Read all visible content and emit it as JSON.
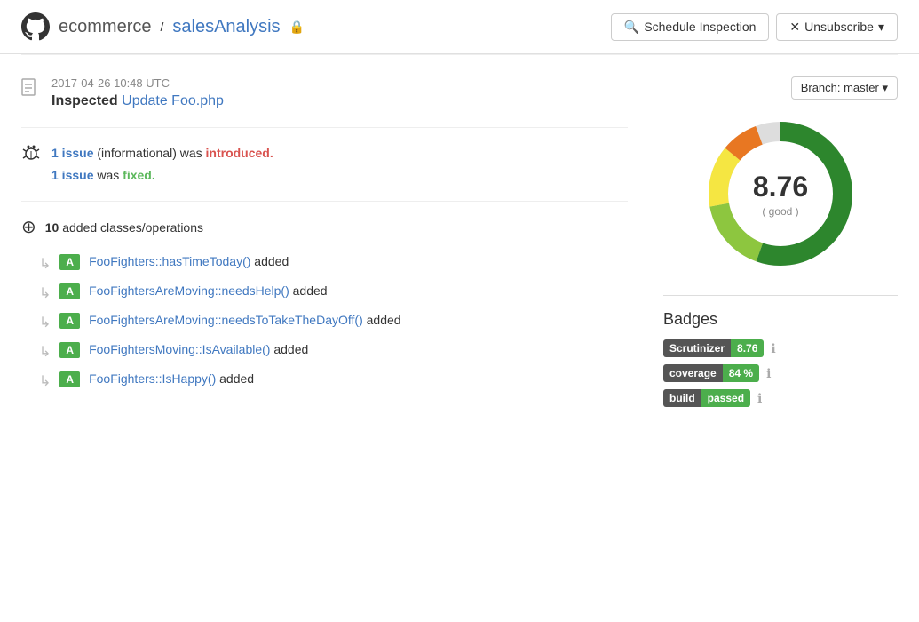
{
  "header": {
    "github_icon": "github-icon",
    "repo_owner": "ecommerce",
    "separator": " / ",
    "repo_name": "salesAnalysis",
    "lock_symbol": "🔒",
    "schedule_btn": "Schedule Inspection",
    "unsubscribe_btn": "Unsubscribe"
  },
  "inspection": {
    "timestamp": "2017-04-26 10:48 UTC",
    "title_prefix": "Inspected",
    "commit_link": "Update Foo.php",
    "issues": {
      "issue1_count": "1 issue",
      "issue1_suffix": "(informational) was",
      "issue1_status": "introduced.",
      "issue2_count": "1 issue",
      "issue2_suffix": "was",
      "issue2_status": "fixed."
    },
    "classes": {
      "count": "10",
      "label": "added classes/operations",
      "items": [
        {
          "badge": "A",
          "text": "FooFighters::hasTimeToday() added"
        },
        {
          "badge": "A",
          "text": "FooFightersAreMoving::needsHelp() added"
        },
        {
          "badge": "A",
          "text": "FooFightersAreMoving::needsToTakeTheDayOff() added"
        },
        {
          "badge": "A",
          "text": "FooFightersMoving::IsAvailable() added"
        },
        {
          "badge": "A",
          "text": "FooFighters::IsHappy() added"
        }
      ]
    }
  },
  "sidebar": {
    "branch_label": "Branch: master",
    "donut": {
      "score": "8.76",
      "label": "( good )"
    },
    "badges_title": "Badges",
    "badges": [
      {
        "left": "Scrutinizer",
        "right": "8.76",
        "type": "score"
      },
      {
        "left": "coverage",
        "right": "84 %",
        "type": "coverage"
      },
      {
        "left": "build",
        "right": "passed",
        "type": "build"
      }
    ]
  }
}
